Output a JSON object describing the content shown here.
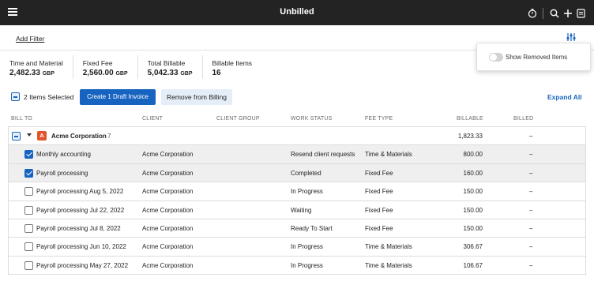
{
  "header": {
    "title": "Unbilled",
    "icons": [
      "timer-icon",
      "search-icon",
      "plus-icon",
      "invoice-icon"
    ]
  },
  "filters": {
    "add_filter_label": "Add Filter"
  },
  "popover": {
    "show_removed_label": "Show Removed Items",
    "show_removed": false
  },
  "summary": [
    {
      "label": "Time and Material",
      "value": "2,482.33",
      "unit": "GBP"
    },
    {
      "label": "Fixed Fee",
      "value": "2,560.00",
      "unit": "GBP"
    },
    {
      "label": "Total Billable",
      "value": "5,042.33",
      "unit": "GBP"
    },
    {
      "label": "Billable Items",
      "value": "16",
      "unit": ""
    }
  ],
  "actions": {
    "selected_label": "2 Items Selected",
    "create_label": "Create 1 Draft Invoice",
    "remove_label": "Remove from Billing",
    "expand_label": "Expand All"
  },
  "columns": {
    "bill_to": "BILL TO",
    "client": "CLIENT",
    "client_group": "CLIENT GROUP",
    "work_status": "WORK STATUS",
    "fee_type": "FEE TYPE",
    "billable": "BILLABLE",
    "billed": "BILLED"
  },
  "group": {
    "badge": "A",
    "name": "Acme Corporation",
    "count": "7",
    "billable": "1,823.33",
    "billed": "–"
  },
  "rows": [
    {
      "name": "Monthly accounting",
      "client": "Acme Corporation",
      "status": "Resend client requests",
      "fee": "Time & Materials",
      "billable": "800.00",
      "billed": "–",
      "checked": true
    },
    {
      "name": "Payroll processing",
      "client": "Acme Corporation",
      "status": "Completed",
      "fee": "Fixed Fee",
      "billable": "160.00",
      "billed": "–",
      "checked": true
    },
    {
      "name": "Payroll processing Aug 5, 2022",
      "client": "Acme Corporation",
      "status": "In Progress",
      "fee": "Fixed Fee",
      "billable": "150.00",
      "billed": "–",
      "checked": false
    },
    {
      "name": "Payroll processing Jul 22, 2022",
      "client": "Acme Corporation",
      "status": "Waiting",
      "fee": "Fixed Fee",
      "billable": "150.00",
      "billed": "–",
      "checked": false
    },
    {
      "name": "Payroll processing Jul 8, 2022",
      "client": "Acme Corporation",
      "status": "Ready To Start",
      "fee": "Fixed Fee",
      "billable": "150.00",
      "billed": "–",
      "checked": false
    },
    {
      "name": "Payroll processing Jun 10, 2022",
      "client": "Acme Corporation",
      "status": "In Progress",
      "fee": "Time & Materials",
      "billable": "306.67",
      "billed": "–",
      "checked": false
    },
    {
      "name": "Payroll processing May 27, 2022",
      "client": "Acme Corporation",
      "status": "In Progress",
      "fee": "Time & Materials",
      "billable": "106.67",
      "billed": "–",
      "checked": false
    }
  ],
  "colors": {
    "accent": "#1764c0",
    "topbar": "#232323",
    "badge": "#e0552b",
    "selected_row": "#efefef"
  }
}
